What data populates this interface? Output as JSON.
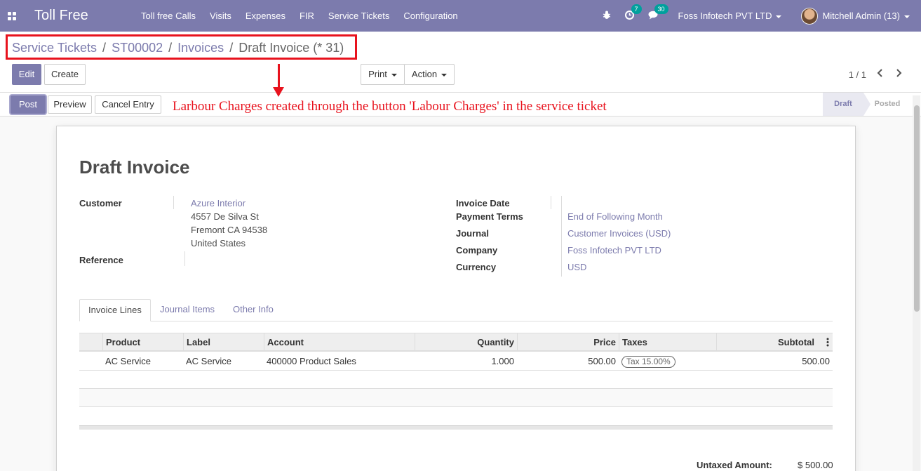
{
  "navbar": {
    "brand": "Toll Free",
    "menu": [
      "Toll free Calls",
      "Visits",
      "Expenses",
      "FIR",
      "Service Tickets",
      "Configuration"
    ],
    "activity_count": "7",
    "message_count": "30",
    "company": "Foss Infotech PVT LTD",
    "user": "Mitchell Admin (13)"
  },
  "breadcrumb": {
    "items": [
      "Service Tickets",
      "ST00002",
      "Invoices"
    ],
    "current": "Draft Invoice (* 31)",
    "separator": "/"
  },
  "buttons": {
    "edit": "Edit",
    "create": "Create",
    "print": "Print",
    "action": "Action",
    "post": "Post",
    "preview": "Preview",
    "cancel_entry": "Cancel Entry"
  },
  "pager": {
    "value": "1 / 1"
  },
  "annotation": "Larbour Charges created through the button 'Labour Charges' in the service ticket",
  "statusbar": {
    "draft": "Draft",
    "posted": "Posted"
  },
  "invoice": {
    "title": "Draft Invoice",
    "customer_label": "Customer",
    "customer_name": "Azure Interior",
    "address_line1": "4557 De Silva St",
    "address_line2": "Fremont CA 94538",
    "address_line3": "United States",
    "reference_label": "Reference",
    "invoice_date_label": "Invoice Date",
    "payment_terms_label": "Payment Terms",
    "payment_terms": "End of Following Month",
    "journal_label": "Journal",
    "journal": "Customer Invoices (USD)",
    "company_label": "Company",
    "company": "Foss Infotech PVT LTD",
    "currency_label": "Currency",
    "currency": "USD"
  },
  "tabs": [
    "Invoice Lines",
    "Journal Items",
    "Other Info"
  ],
  "table": {
    "headers": [
      "Product",
      "Label",
      "Account",
      "Quantity",
      "Price",
      "Taxes",
      "Subtotal"
    ],
    "rows": [
      {
        "product": "AC Service",
        "label": "AC Service",
        "account": "400000 Product Sales",
        "quantity": "1.000",
        "price": "500.00",
        "tax": "Tax 15.00%",
        "subtotal": "500.00"
      }
    ]
  },
  "totals": {
    "untaxed_label": "Untaxed Amount:",
    "untaxed_value": "$ 500.00"
  },
  "colors": {
    "brand": "#7c7bad",
    "annotation": "#e8121d",
    "badge": "#00a09d"
  }
}
